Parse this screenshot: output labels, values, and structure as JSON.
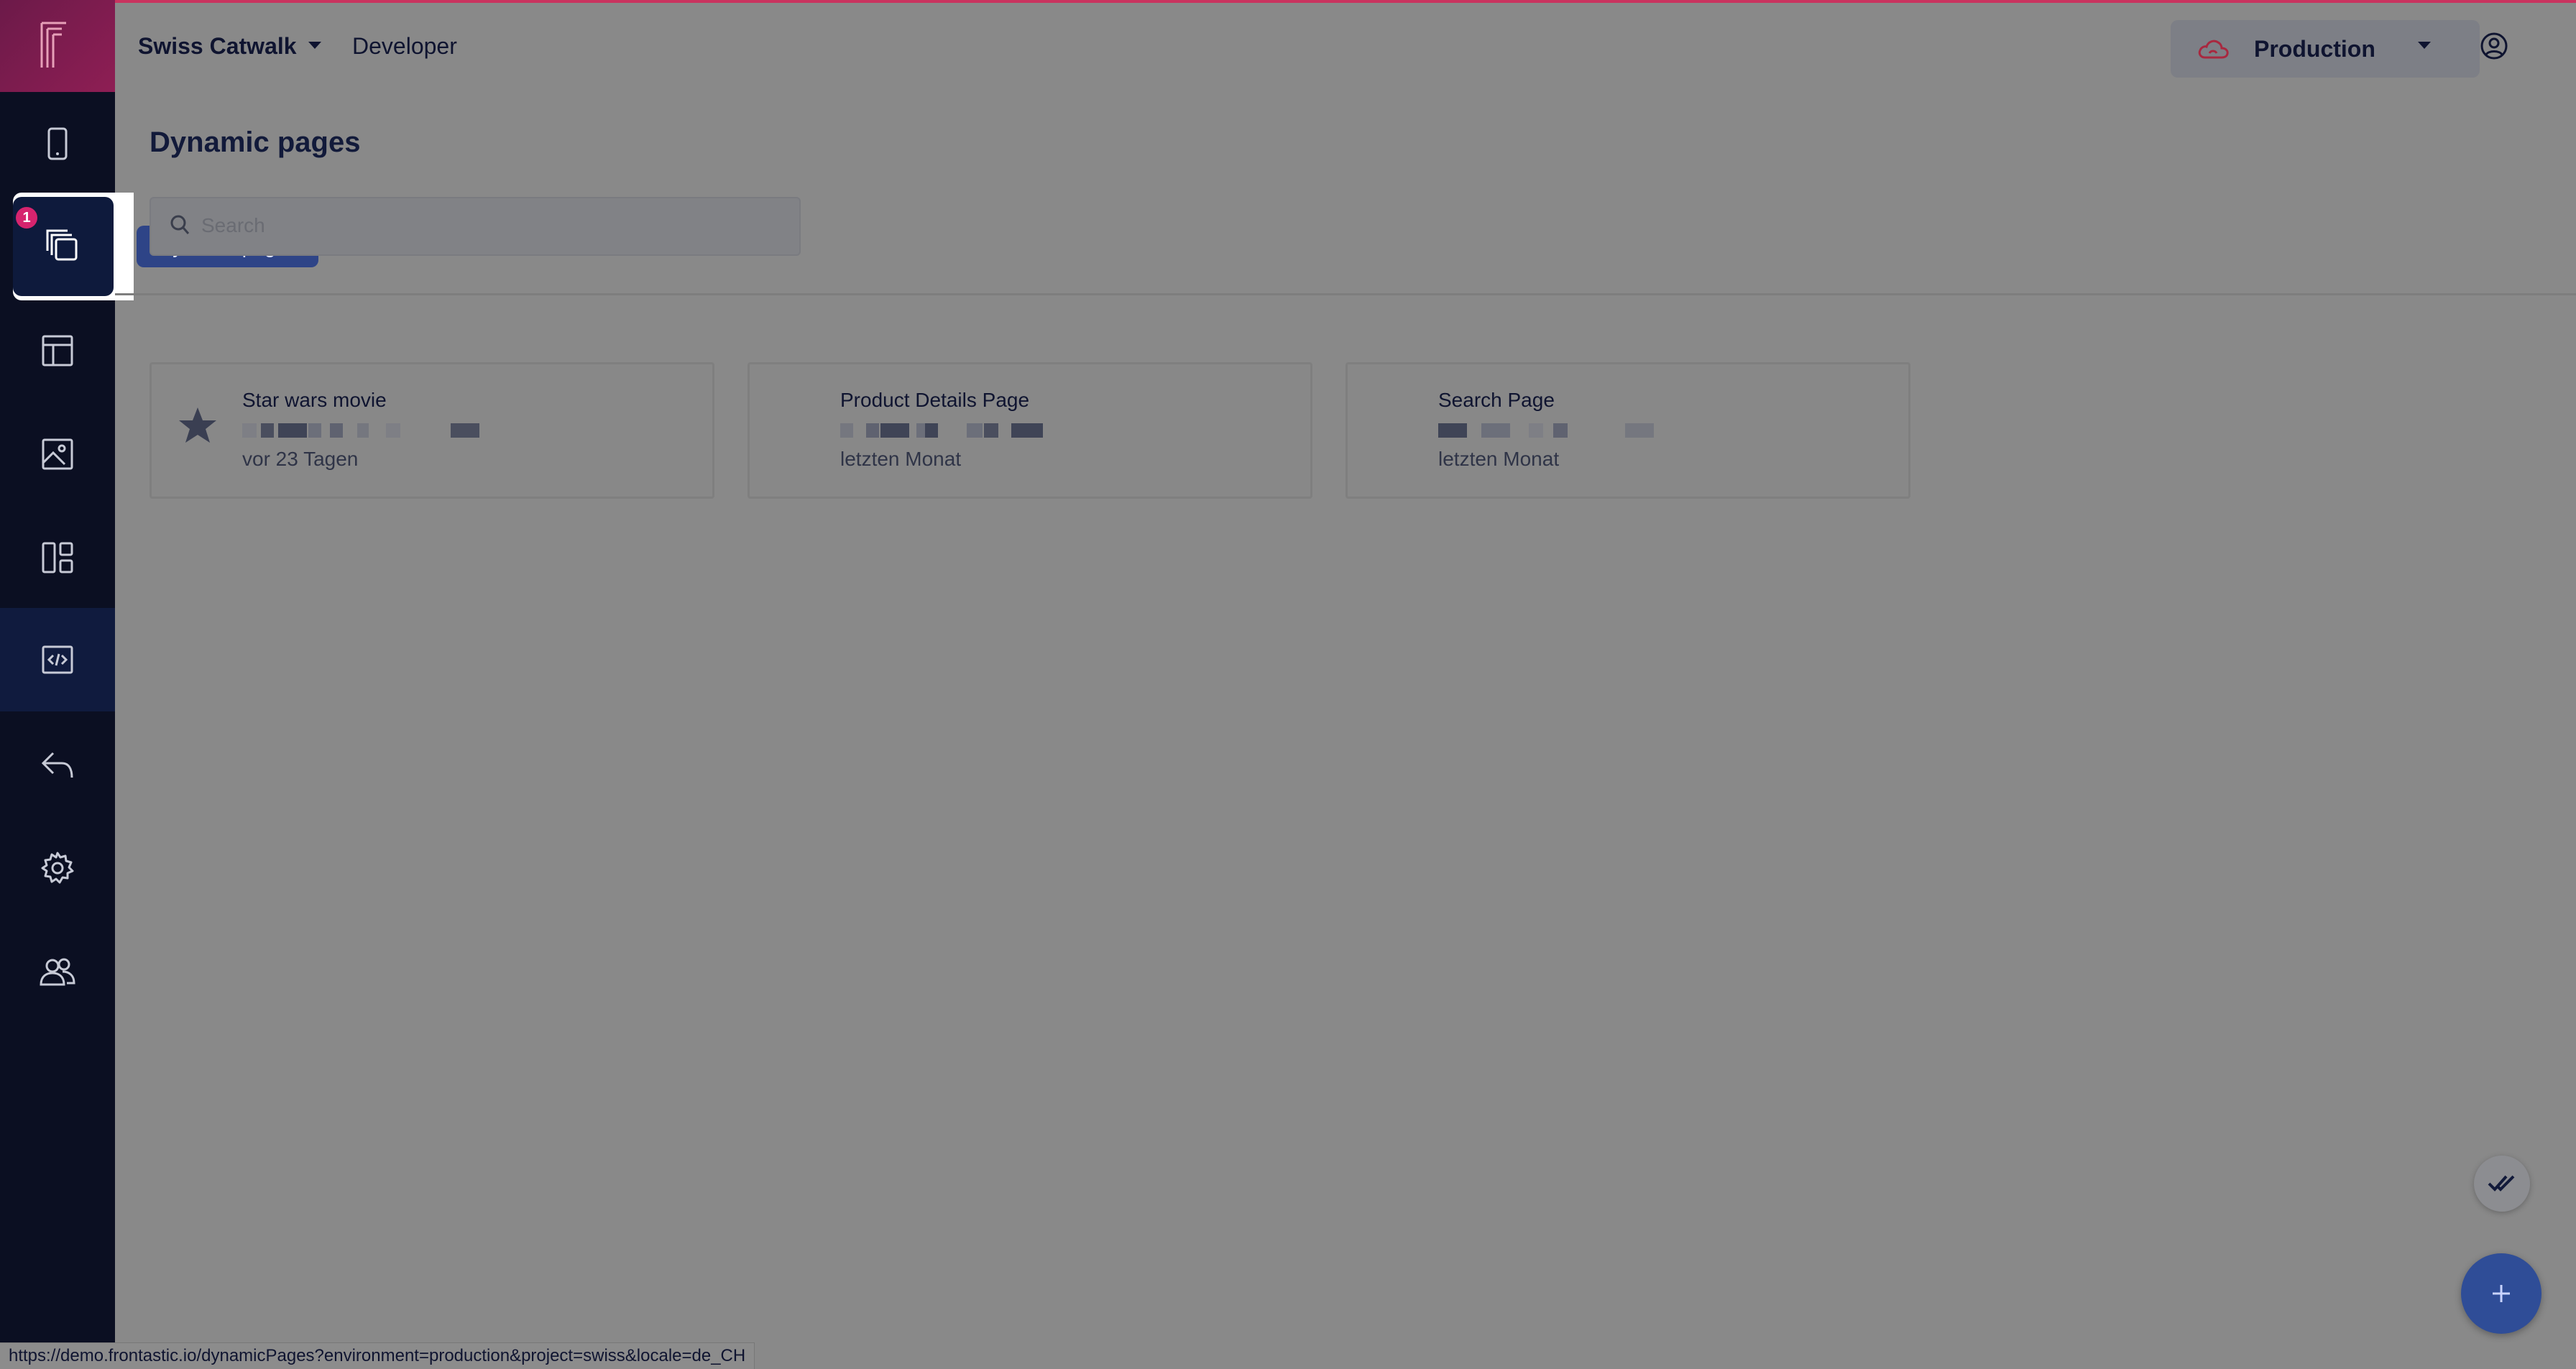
{
  "header": {
    "project_name": "Swiss Catwalk",
    "role": "Developer",
    "environment": "Production"
  },
  "sidebar": {
    "items": [
      {
        "name": "mobile-icon"
      },
      {
        "name": "dynamic-pages-icon",
        "badge": "1",
        "selected": true
      },
      {
        "name": "layout-icon"
      },
      {
        "name": "media-icon"
      },
      {
        "name": "components-icon"
      },
      {
        "name": "developer-code-icon",
        "active": true
      },
      {
        "name": "undo-icon"
      },
      {
        "name": "settings-icon"
      },
      {
        "name": "users-icon"
      }
    ],
    "tooltip": "Dynamic pages"
  },
  "main": {
    "title": "Dynamic pages",
    "search_placeholder": "Search",
    "cards": [
      {
        "title": "Star wars movie",
        "date": "vor 23 Tagen",
        "starred": true
      },
      {
        "title": "Product Details Page",
        "date": "letzten Monat",
        "starred": false
      },
      {
        "title": "Search Page",
        "date": "letzten Monat",
        "starred": false
      }
    ]
  },
  "status_bar": {
    "url": "https://demo.frontastic.io/dynamicPages?environment=production&project=swiss&locale=de_CH"
  },
  "colors": {
    "brand": "#8e1e54",
    "sidebar": "#0b0f22",
    "accent": "#2f4d97",
    "badge": "#d6246e"
  }
}
